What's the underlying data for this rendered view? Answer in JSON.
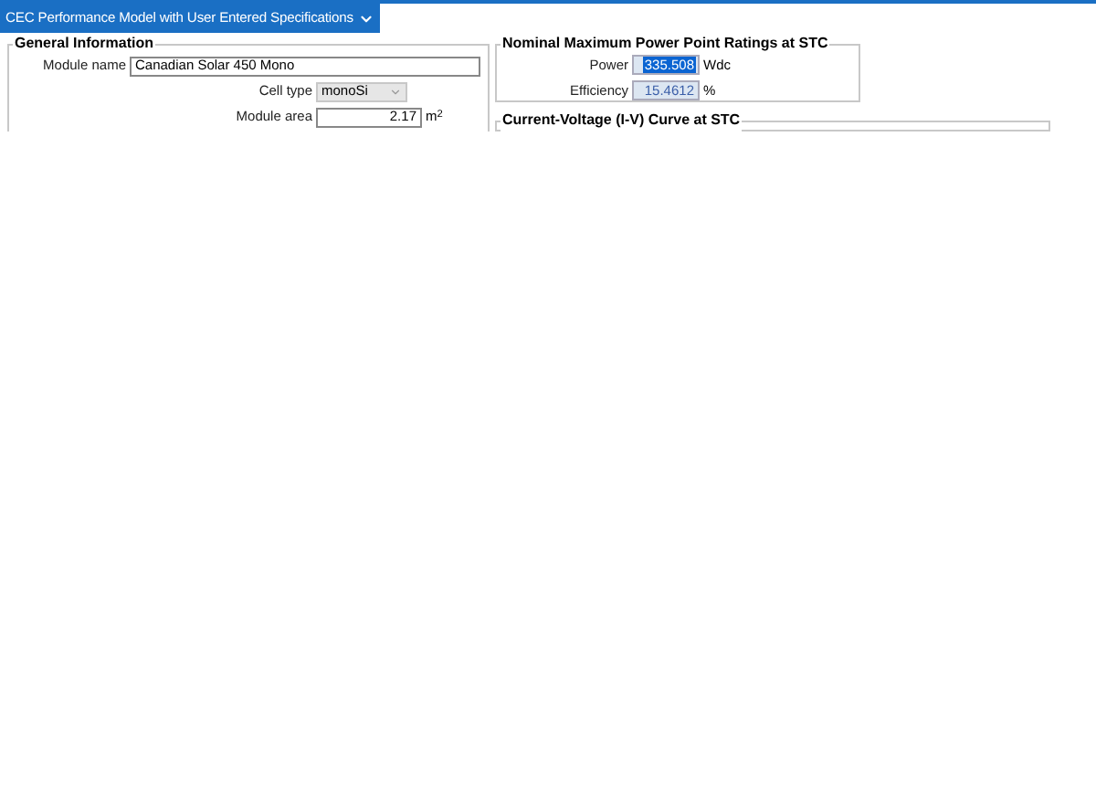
{
  "header": {
    "title": "CEC Performance Model with User Entered Specifications"
  },
  "general": {
    "title": "General Information",
    "fields": [
      {
        "kind": "text",
        "label": "Module name",
        "value": "Canadian Solar 450 Mono"
      },
      {
        "kind": "select",
        "label": "Cell type",
        "value": "monoSi",
        "disabled": true
      },
      {
        "kind": "number",
        "label": "Module area",
        "value": "2.17",
        "unit": "m$^{2}$"
      }
    ]
  },
  "ratings": {
    "title": "Nominal Maximum Power Point Ratings at STC",
    "fields": [
      {
        "label": "Power",
        "value": "335.508",
        "unit": "Wdc",
        "selected": true
      },
      {
        "label": "Efficiency",
        "value": "15.4612",
        "unit": "%",
        "selected": false
      }
    ]
  },
  "iv_curve": {
    "title": "Current-Voltage (I-V) Curve at STC"
  }
}
